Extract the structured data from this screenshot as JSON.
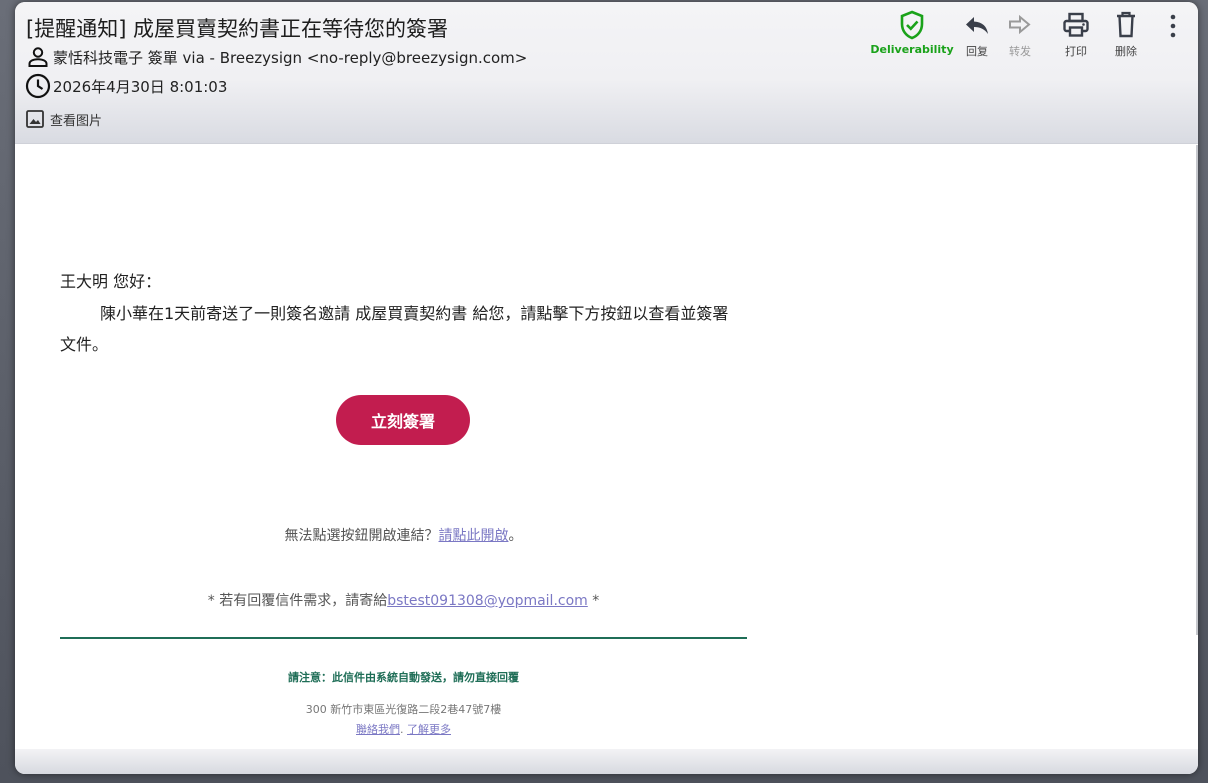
{
  "email": {
    "subject": "[提醒通知] 成屋買賣契約書正在等待您的簽署",
    "sender": "蒙恬科技電子 簽單 via - Breezysign <no-reply@breezysign.com>",
    "date": "2026年4月30日 8:01:03",
    "view_images": "查看图片"
  },
  "toolbar": {
    "deliverability": "Deliverability",
    "reply": "回复",
    "forward": "转发",
    "print": "打印",
    "delete": "删除"
  },
  "body": {
    "greeting": "王大明 您好：",
    "message": "陳小華在1天前寄送了一則簽名邀請 成屋買賣契約書 給您，請點擊下方按鈕以查看並簽署文件。",
    "sign_button": "立刻簽署",
    "fallback_text": "無法點選按鈕開啟連結？",
    "fallback_link": "請點此開啟",
    "fallback_end": "。",
    "reply_prefix": "* 若有回覆信件需求，請寄給",
    "reply_email": "bstest091308@yopmail.com",
    "reply_suffix": " *",
    "notice": "請注意：此信件由系統自動發送，請勿直接回覆",
    "address": "300 新竹市東區光復路二段2巷47號7樓",
    "contact_link": "聯絡我們",
    "link_separator": ". ",
    "more_link": "了解更多"
  },
  "colors": {
    "accent_button": "#c21d4f",
    "footer_green": "#1f6e57",
    "link": "#7b78c4",
    "deliverability_green": "#1aa21a"
  }
}
